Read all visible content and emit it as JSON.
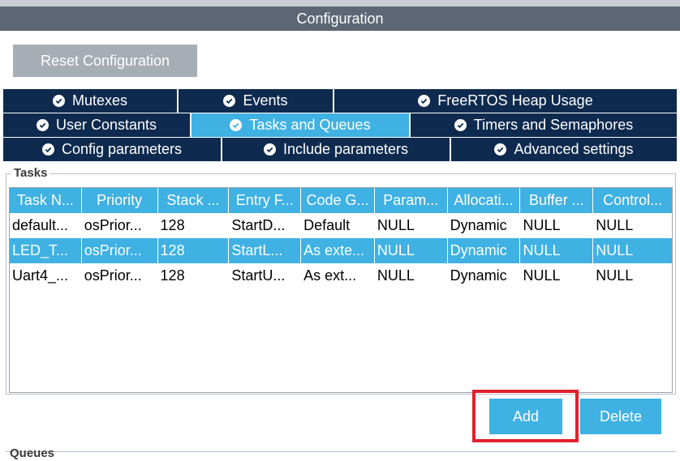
{
  "window": {
    "title": "Configuration"
  },
  "toolbar": {
    "reset_label": "Reset Configuration"
  },
  "tabs": {
    "row1": [
      {
        "label": "Mutexes",
        "active": false
      },
      {
        "label": "Events",
        "active": false
      },
      {
        "label": "FreeRTOS Heap Usage",
        "active": false
      }
    ],
    "row2": [
      {
        "label": "User Constants",
        "active": false
      },
      {
        "label": "Tasks and Queues",
        "active": true
      },
      {
        "label": "Timers and Semaphores",
        "active": false
      }
    ],
    "row3": [
      {
        "label": "Config parameters",
        "active": false
      },
      {
        "label": "Include parameters",
        "active": false
      },
      {
        "label": "Advanced settings",
        "active": false
      }
    ]
  },
  "tasks": {
    "group_label": "Tasks",
    "columns": [
      "Task N...",
      "Priority",
      "Stack ...",
      "Entry F...",
      "Code G...",
      "Param...",
      "Allocati...",
      "Buffer ...",
      "Control..."
    ],
    "rows": [
      {
        "cells": [
          "default...",
          "osPrior...",
          "128",
          "StartD...",
          "Default",
          "NULL",
          "Dynamic",
          "NULL",
          "NULL"
        ],
        "selected": false
      },
      {
        "cells": [
          "LED_T...",
          "osPrior...",
          "128",
          "StartL...",
          "As exte...",
          "NULL",
          "Dynamic",
          "NULL",
          "NULL"
        ],
        "selected": true
      },
      {
        "cells": [
          "Uart4_...",
          "osPrior...",
          "128",
          "StartU...",
          "As ext...",
          "NULL",
          "Dynamic",
          "NULL",
          "NULL"
        ],
        "selected": false
      }
    ],
    "add_label": "Add",
    "delete_label": "Delete"
  },
  "queues": {
    "group_label": "Queues"
  },
  "colors": {
    "accent": "#3fb1e3",
    "tab_dark": "#0e2a4e",
    "title_bar": "#5d6674",
    "highlight": "#e0202a"
  }
}
